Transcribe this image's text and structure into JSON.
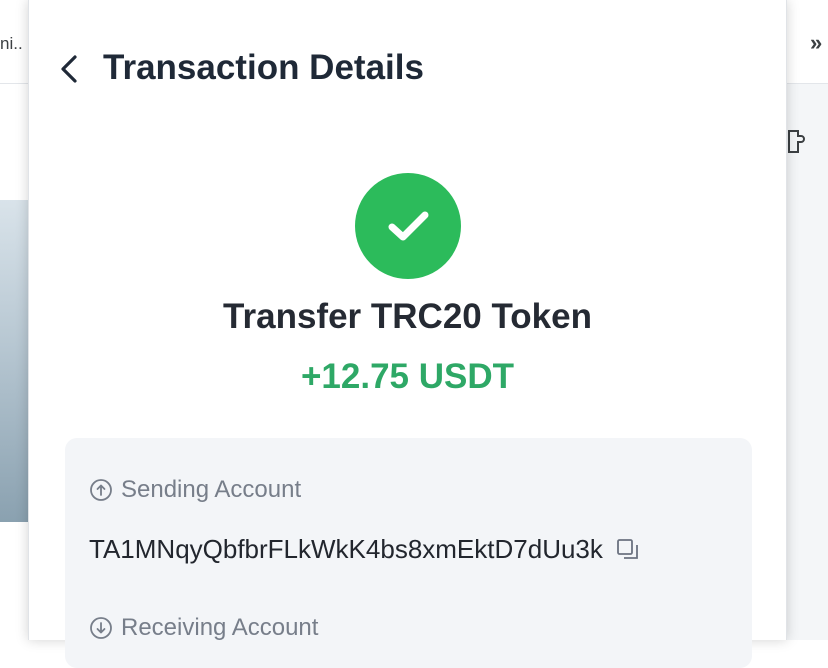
{
  "browser": {
    "tab_text": "ni..",
    "overflow_chevrons": "»",
    "extension_icon": "puzzle-icon"
  },
  "header": {
    "back_icon": "chevron-left-icon",
    "title": "Transaction Details"
  },
  "status": {
    "icon": "check-circle-icon",
    "color": "#2cbb5b"
  },
  "transaction": {
    "type": "Transfer TRC20 Token",
    "amount": "+12.75 USDT",
    "amount_color": "#2ea866"
  },
  "details": {
    "sending": {
      "icon": "arrow-up-circle-icon",
      "label": "Sending Account",
      "value": "TA1MNqyQbfbrFLkWkK4bs8xmEktD7dUu3k",
      "copy_icon": "copy-icon"
    },
    "receiving": {
      "icon": "arrow-down-circle-icon",
      "label": "Receiving Account"
    }
  }
}
